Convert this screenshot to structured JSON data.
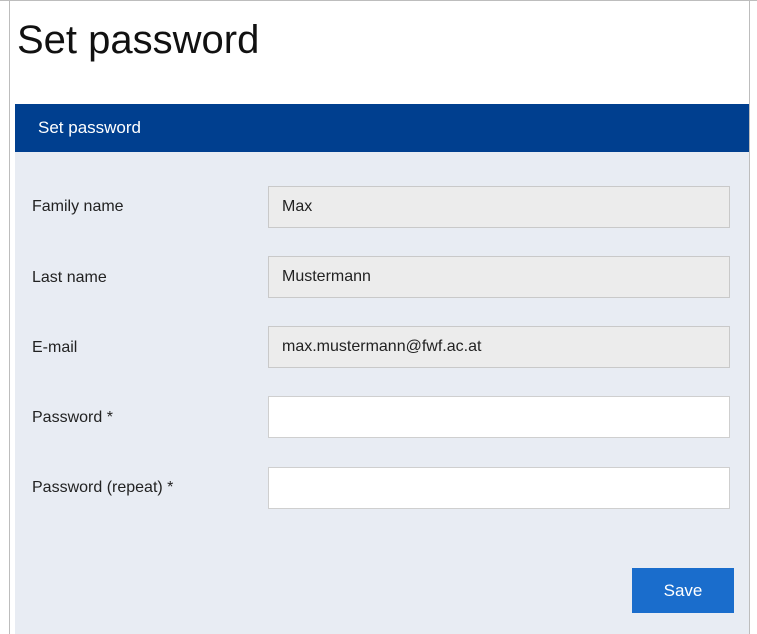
{
  "page": {
    "title": "Set password"
  },
  "panel": {
    "header_title": "Set password"
  },
  "form": {
    "fields": [
      {
        "label": "Family name",
        "value": "Max",
        "readonly": true
      },
      {
        "label": "Last name",
        "value": "Mustermann",
        "readonly": true
      },
      {
        "label": "E-mail",
        "value": "max.mustermann@fwf.ac.at",
        "readonly": true
      },
      {
        "label": "Password *",
        "value": "",
        "readonly": false
      },
      {
        "label": "Password (repeat) *",
        "value": "",
        "readonly": false
      }
    ],
    "save_label": "Save"
  },
  "colors": {
    "header_background": "#003f8f",
    "panel_background": "#e8ecf3",
    "readonly_field_background": "#ececec",
    "button_background": "#1a6dcc"
  }
}
